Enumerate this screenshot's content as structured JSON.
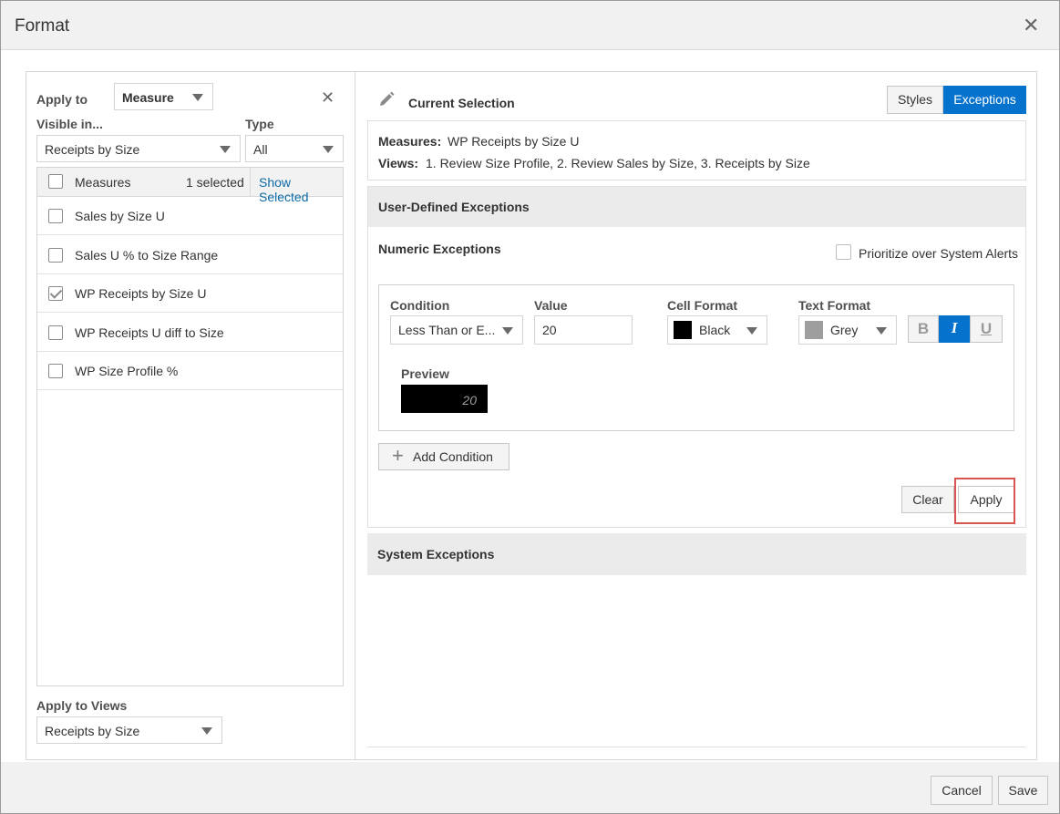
{
  "dialog": {
    "title": "Format"
  },
  "left": {
    "apply_to_label": "Apply to",
    "apply_to_value": "Measure",
    "visible_in_label": "Visible in...",
    "visible_in_value": "Receipts by Size",
    "type_label": "Type",
    "type_value": "All",
    "list_header": {
      "title": "Measures",
      "count": "1 selected",
      "show_selected": "Show Selected"
    },
    "measures": [
      {
        "label": "Sales by Size U",
        "checked": false
      },
      {
        "label": "Sales U % to Size Range",
        "checked": false
      },
      {
        "label": "WP Receipts by Size U",
        "checked": true
      },
      {
        "label": "WP Receipts U diff to Size",
        "checked": false
      },
      {
        "label": "WP Size Profile %",
        "checked": false
      }
    ],
    "apply_to_views_label": "Apply to Views",
    "apply_to_views_value": "Receipts by Size"
  },
  "right": {
    "current_selection_title": "Current Selection",
    "tabs": {
      "styles": "Styles",
      "exceptions": "Exceptions"
    },
    "measures_label": "Measures:",
    "measures_value": "WP Receipts by Size U",
    "views_label": "Views:",
    "views_value": "1. Review Size Profile, 2. Review Sales by Size, 3. Receipts by Size",
    "user_defined_title": "User-Defined Exceptions",
    "numeric_title": "Numeric Exceptions",
    "prioritize_label": "Prioritize over System Alerts",
    "condition_label": "Condition",
    "condition_value": "Less Than or E...",
    "value_label": "Value",
    "value_value": "20",
    "cell_format_label": "Cell Format",
    "cell_format_value": "Black",
    "cell_format_color": "#000000",
    "text_format_label": "Text Format",
    "text_format_value": "Grey",
    "text_format_color": "#9e9e9e",
    "bold": "B",
    "italic": "I",
    "underline": "U",
    "preview_label": "Preview",
    "preview_value": "20",
    "add_condition": "Add Condition",
    "clear": "Clear",
    "apply": "Apply",
    "system_title": "System Exceptions"
  },
  "footer": {
    "cancel": "Cancel",
    "save": "Save"
  },
  "colors": {
    "accent": "#0572ce",
    "highlight_box": "#d9534f"
  }
}
